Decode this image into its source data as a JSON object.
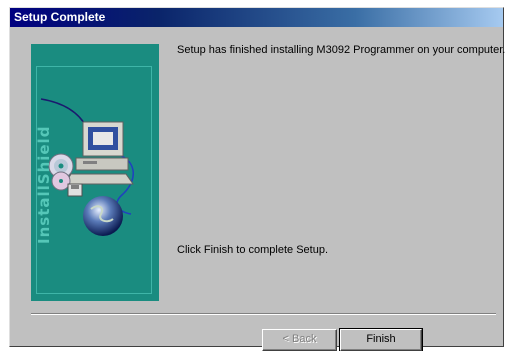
{
  "window": {
    "title": "Setup Complete"
  },
  "side_panel": {
    "brand_text": "InstallShield",
    "colors": {
      "background": "#1a8c80",
      "frame": "#3fb5a8"
    },
    "icons": [
      "computer-icon",
      "cd-disc-icon",
      "floppy-disk-icon",
      "globe-icon"
    ]
  },
  "content": {
    "finished_message": "Setup has finished installing M3092 Programmer on your computer.",
    "instruction": "Click Finish to complete Setup."
  },
  "buttons": {
    "back_label": "< Back",
    "back_enabled": false,
    "finish_label": "Finish"
  },
  "colors": {
    "titlebar_start": "#000080",
    "titlebar_end": "#a6caf0",
    "dialog_background": "#c0c0c0"
  }
}
